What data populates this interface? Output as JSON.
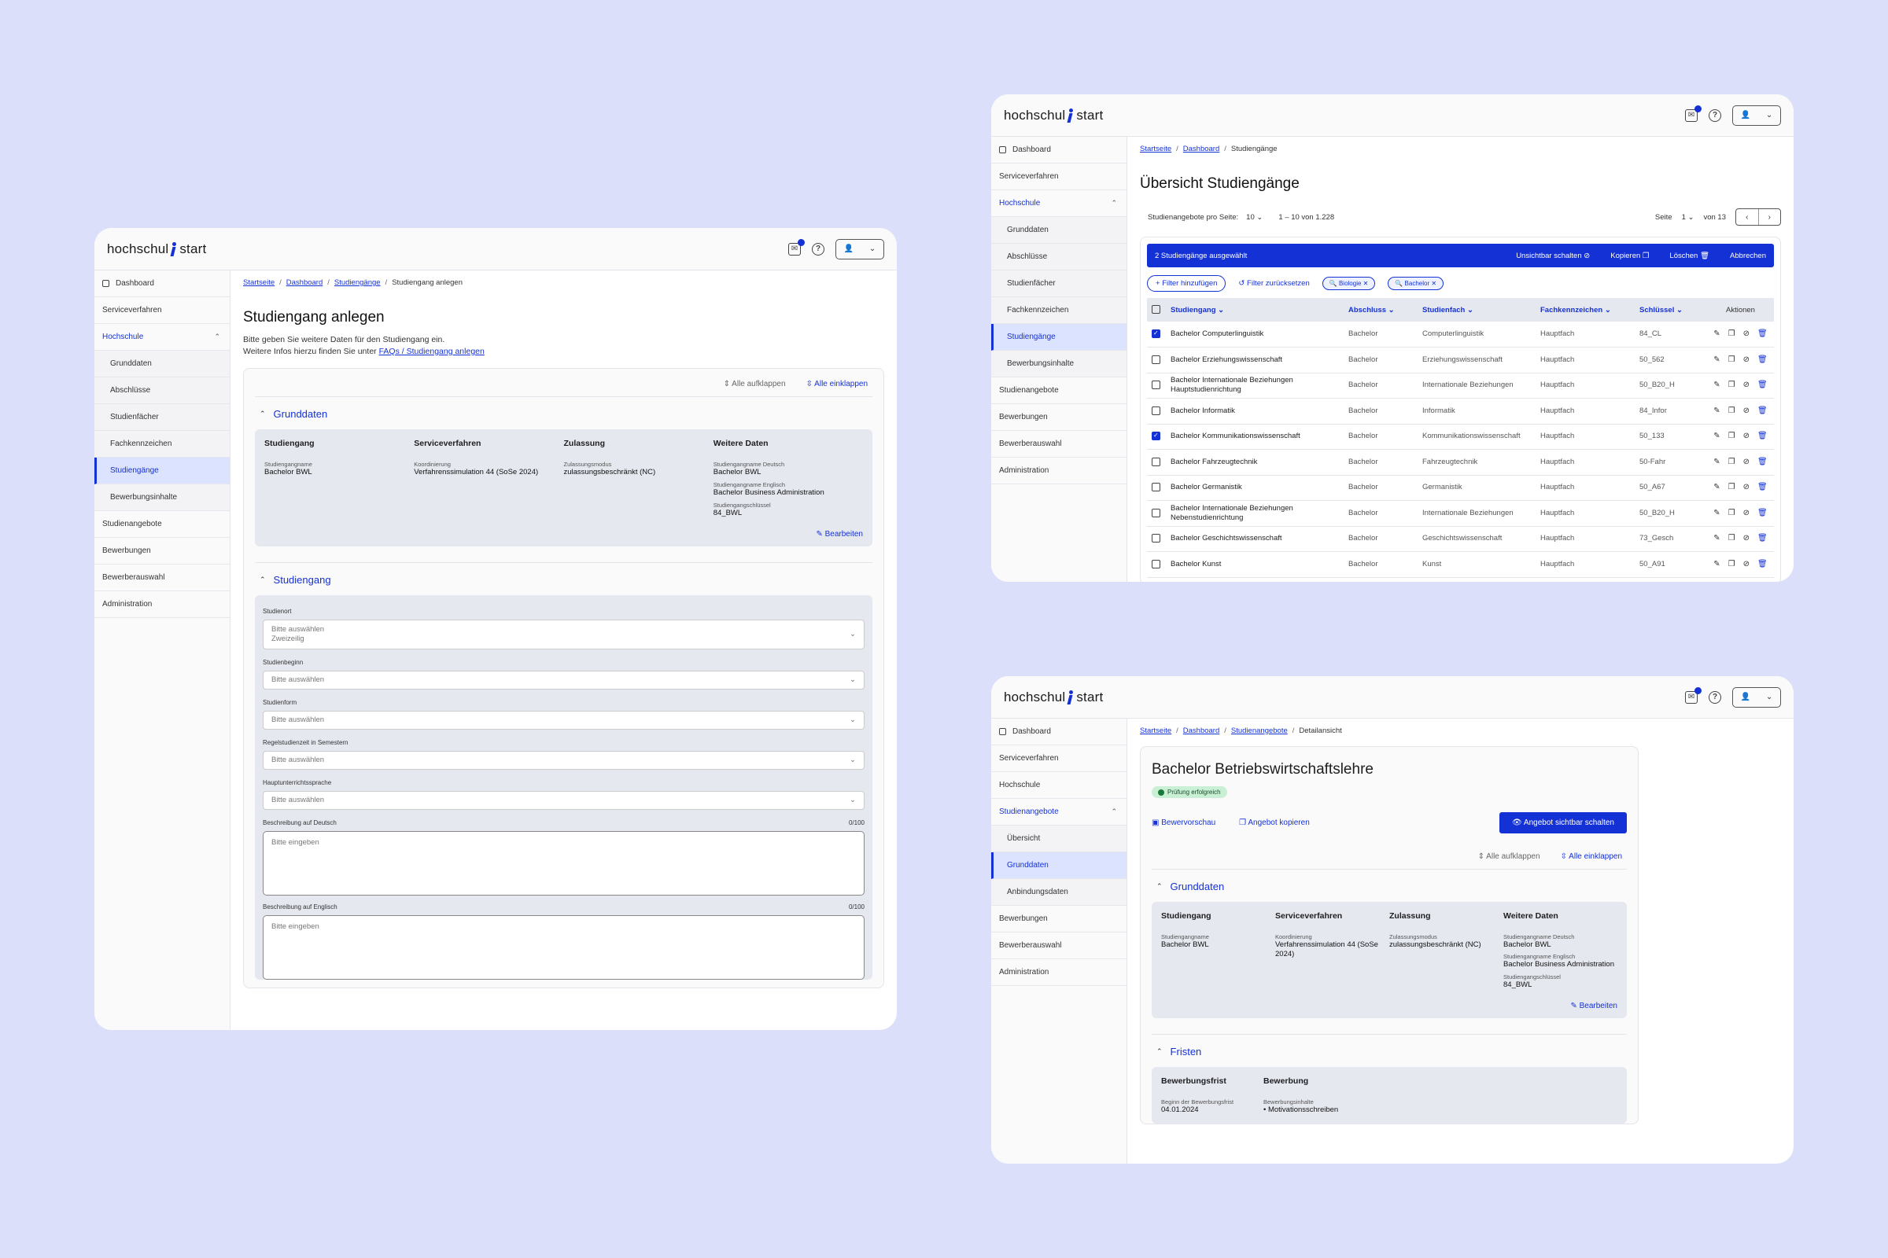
{
  "brand": {
    "logo_left": "hochschul",
    "logo_right": "start",
    "accent": "#1431d6"
  },
  "w1": {
    "sidebar": [
      {
        "label": "Dashboard",
        "type": "top"
      },
      {
        "label": "Serviceverfahren",
        "type": "top"
      },
      {
        "label": "Hochschule",
        "type": "open"
      },
      {
        "label": "Grunddaten",
        "type": "sub"
      },
      {
        "label": "Abschlüsse",
        "type": "sub"
      },
      {
        "label": "Studienfächer",
        "type": "sub"
      },
      {
        "label": "Fachkennzeichen",
        "type": "sub"
      },
      {
        "label": "Studiengänge",
        "type": "active"
      },
      {
        "label": "Bewerbungsinhalte",
        "type": "sub"
      },
      {
        "label": "Studienangebote",
        "type": "top"
      },
      {
        "label": "Bewerbungen",
        "type": "top"
      },
      {
        "label": "Bewerberauswahl",
        "type": "top"
      },
      {
        "label": "Administration",
        "type": "top"
      }
    ],
    "breadcrumb": [
      "Startseite",
      "Dashboard",
      "Studiengänge",
      "Studiengang anlegen"
    ],
    "title": "Studiengang anlegen",
    "lead1": "Bitte geben Sie weitere Daten für den Studiengang ein.",
    "lead2": "Weitere Infos hierzu finden Sie unter",
    "lead_link": "FAQs / Studiengang anlegen",
    "expand_all": "Alle aufklappen",
    "collapse_all": "Alle einklappen",
    "section1": "Grunddaten",
    "section2": "Studiengang",
    "edit": "Bearbeiten",
    "info": {
      "col1": {
        "head": "Studiengang",
        "l1": "Studiengangname",
        "v1": "Bachelor BWL"
      },
      "col2": {
        "head": "Serviceverfahren",
        "l1": "Koordinierung",
        "v1": "Verfahrenssimulation 44 (SoSe 2024)"
      },
      "col3": {
        "head": "Zulassung",
        "l1": "Zulassungsmodus",
        "v1": "zulassungsbeschränkt (NC)"
      },
      "col4": {
        "head": "Weitere Daten",
        "l1": "Studiengangname Deutsch",
        "v1": "Bachelor BWL",
        "l2": "Studiengangname Englisch",
        "v2": "Bachelor Business Administration",
        "l3": "Studiengangschlüssel",
        "v3": "84_BWL"
      }
    },
    "form": {
      "studienort": "Studienort",
      "select_ph": "Bitte auswählen",
      "zweizeilig": "Zweizeilig",
      "studienbeginn": "Studienbeginn",
      "studienform": "Studienform",
      "regelstudienzeit": "Regelstudienzeit in Semestern",
      "sprache": "Hauptunterrichtssprache",
      "desc_de": "Beschreibung auf Deutsch",
      "desc_en": "Beschreibung auf Englisch",
      "counter": "0/100",
      "input_ph": "Bitte eingeben"
    }
  },
  "w2": {
    "sidebar": [
      {
        "label": "Dashboard",
        "type": "top"
      },
      {
        "label": "Serviceverfahren",
        "type": "top"
      },
      {
        "label": "Hochschule",
        "type": "open"
      },
      {
        "label": "Grunddaten",
        "type": "sub"
      },
      {
        "label": "Abschlüsse",
        "type": "sub"
      },
      {
        "label": "Studienfächer",
        "type": "sub"
      },
      {
        "label": "Fachkennzeichen",
        "type": "sub"
      },
      {
        "label": "Studiengänge",
        "type": "active"
      },
      {
        "label": "Bewerbungsinhalte",
        "type": "sub"
      },
      {
        "label": "Studienangebote",
        "type": "top"
      },
      {
        "label": "Bewerbungen",
        "type": "top"
      },
      {
        "label": "Bewerberauswahl",
        "type": "top"
      },
      {
        "label": "Administration",
        "type": "top"
      }
    ],
    "breadcrumb": [
      "Startseite",
      "Dashboard",
      "Studiengänge"
    ],
    "title": "Übersicht Studiengänge",
    "per_page_label": "Studienangebote pro Seite:",
    "per_page": "10",
    "range": "1 – 10 von 1.228",
    "page_label": "Seite",
    "page": "1",
    "page_of": "von 13",
    "selected": "2 Studiengänge ausgewählt",
    "bulk": [
      "Unsichtbar schalten",
      "Kopieren",
      "Löschen",
      "Abbrechen"
    ],
    "add_filter": "Filter hinzufügen",
    "reset_filter": "Filter zurücksetzen",
    "chips": [
      "Biologie",
      "Bachelor"
    ],
    "columns": [
      "Studiengang",
      "Abschluss",
      "Studienfach",
      "Fachkennzeichen",
      "Schlüssel",
      "Aktionen"
    ],
    "rows": [
      {
        "checked": true,
        "name": "Bachelor Computerlinguistik",
        "abschluss": "Bachelor",
        "fach": "Computerlinguistik",
        "kz": "Hauptfach",
        "key": "84_CL"
      },
      {
        "checked": false,
        "name": "Bachelor Erziehungswissenschaft",
        "abschluss": "Bachelor",
        "fach": "Erziehungswissenschaft",
        "kz": "Hauptfach",
        "key": "50_562"
      },
      {
        "checked": false,
        "name": "Bachelor Internationale Beziehungen Hauptstudienrichtung",
        "abschluss": "Bachelor",
        "fach": "Internationale Beziehungen",
        "kz": "Hauptfach",
        "key": "50_B20_H"
      },
      {
        "checked": false,
        "name": "Bachelor Informatik",
        "abschluss": "Bachelor",
        "fach": "Informatik",
        "kz": "Hauptfach",
        "key": "84_Infor"
      },
      {
        "checked": true,
        "name": "Bachelor Kommunikationswissenschaft",
        "abschluss": "Bachelor",
        "fach": "Kommunikationswissenschaft",
        "kz": "Hauptfach",
        "key": "50_133"
      },
      {
        "checked": false,
        "name": "Bachelor Fahrzeugtechnik",
        "abschluss": "Bachelor",
        "fach": "Fahrzeugtechnik",
        "kz": "Hauptfach",
        "key": "50-Fahr"
      },
      {
        "checked": false,
        "name": "Bachelor Germanistik",
        "abschluss": "Bachelor",
        "fach": "Germanistik",
        "kz": "Hauptfach",
        "key": "50_A67"
      },
      {
        "checked": false,
        "name": "Bachelor Internationale Beziehungen Nebenstudienrichtung",
        "abschluss": "Bachelor",
        "fach": "Internationale Beziehungen",
        "kz": "Hauptfach",
        "key": "50_B20_H"
      },
      {
        "checked": false,
        "name": "Bachelor Geschichtswissenschaft",
        "abschluss": "Bachelor",
        "fach": "Geschichtswissenschaft",
        "kz": "Hauptfach",
        "key": "73_Gesch"
      },
      {
        "checked": false,
        "name": "Bachelor Kunst",
        "abschluss": "Bachelor",
        "fach": "Kunst",
        "kz": "Hauptfach",
        "key": "50_A91"
      }
    ]
  },
  "w3": {
    "sidebar": [
      {
        "label": "Dashboard",
        "type": "top"
      },
      {
        "label": "Serviceverfahren",
        "type": "top"
      },
      {
        "label": "Hochschule",
        "type": "top"
      },
      {
        "label": "Studienangebote",
        "type": "open"
      },
      {
        "label": "Übersicht",
        "type": "sub"
      },
      {
        "label": "Grunddaten",
        "type": "active"
      },
      {
        "label": "Anbindungsdaten",
        "type": "sub"
      },
      {
        "label": "Bewerbungen",
        "type": "top"
      },
      {
        "label": "Bewerberauswahl",
        "type": "top"
      },
      {
        "label": "Administration",
        "type": "top"
      }
    ],
    "breadcrumb": [
      "Startseite",
      "Dashboard",
      "Studienangebote",
      "Detailansicht"
    ],
    "title": "Bachelor Betriebswirtschaftslehre",
    "badge": "Prüfung erfolgreich",
    "preview": "Bewervorschau",
    "copy": "Angebot kopieren",
    "visible": "Angebot sichtbar schalten",
    "expand_all": "Alle aufklappen",
    "collapse_all": "Alle einklappen",
    "section1": "Grunddaten",
    "section2": "Fristen",
    "edit": "Bearbeiten",
    "info": {
      "col1": {
        "head": "Studiengang",
        "l1": "Studiengangname",
        "v1": "Bachelor BWL"
      },
      "col2": {
        "head": "Serviceverfahren",
        "l1": "Koordinierung",
        "v1": "Verfahrenssimulation 44 (SoSe 2024)"
      },
      "col3": {
        "head": "Zulassung",
        "l1": "Zulassungsmodus",
        "v1": "zulassungsbeschränkt (NC)"
      },
      "col4": {
        "head": "Weitere Daten",
        "l1": "Studiengangname Deutsch",
        "v1": "Bachelor BWL",
        "l2": "Studiengangname Englisch",
        "v2": "Bachelor Business Administration",
        "l3": "Studiengangschlüssel",
        "v3": "84_BWL"
      }
    },
    "fristen": {
      "col1": {
        "head": "Bewerbungsfrist",
        "l1": "Beginn der Bewerbungsfrist",
        "v1": "04.01.2024"
      },
      "col2": {
        "head": "Bewerbung",
        "l1": "Bewerbungsinhalte",
        "v1": "Motivationsschreiben"
      }
    }
  }
}
